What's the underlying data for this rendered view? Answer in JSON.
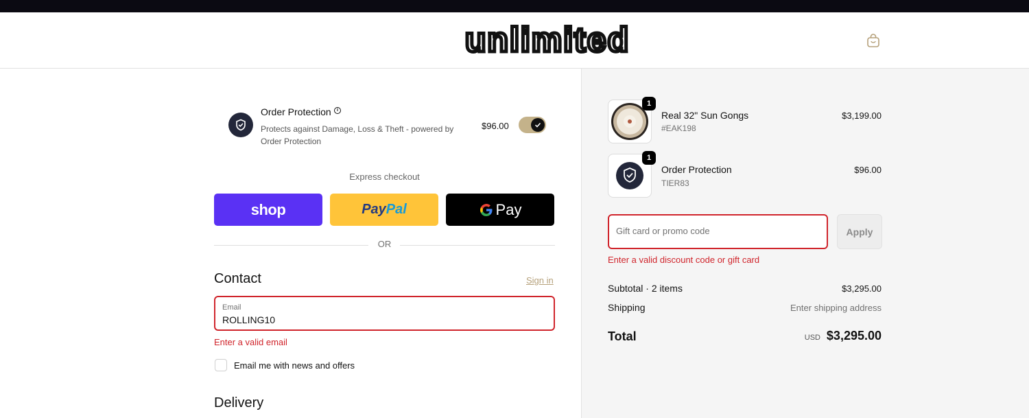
{
  "header": {
    "brand": "unlimited",
    "cart_icon": "shopping-bag-icon"
  },
  "order_protection": {
    "title": "Order Protection",
    "info_icon": "info-icon",
    "description": "Protects against Damage, Loss & Theft - powered by Order Protection",
    "price": "$96.00",
    "enabled": true
  },
  "express": {
    "label": "Express checkout",
    "shop": "shop",
    "paypal_a": "Pay",
    "paypal_b": "Pal",
    "gpay": "Pay",
    "or": "OR"
  },
  "contact": {
    "heading": "Contact",
    "signin": "Sign in",
    "email_label": "Email",
    "email_value": "ROLLING10",
    "email_error": "Enter a valid email",
    "newsletter": "Email me with news and offers"
  },
  "delivery": {
    "heading": "Delivery"
  },
  "cart": {
    "items": [
      {
        "name": "Real 32\" Sun Gongs",
        "sku": "#EAK198",
        "price": "$3,199.00",
        "qty": "1"
      },
      {
        "name": "Order Protection",
        "sku": "TIER83",
        "price": "$96.00",
        "qty": "1"
      }
    ],
    "promo_placeholder": "Gift card or promo code",
    "apply": "Apply",
    "promo_error": "Enter a valid discount code or gift card",
    "subtotal_label": "Subtotal · 2 items",
    "subtotal_value": "$3,295.00",
    "shipping_label": "Shipping",
    "shipping_value": "Enter shipping address",
    "total_label": "Total",
    "currency": "USD",
    "total_value": "$3,295.00"
  },
  "colors": {
    "accent": "#c4b28a",
    "error": "#d0242b",
    "shop": "#5a31f4",
    "paypal": "#ffc439"
  }
}
